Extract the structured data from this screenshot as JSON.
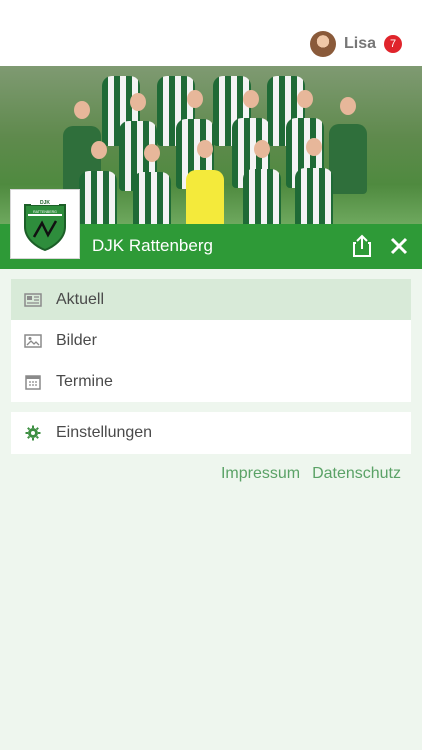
{
  "header": {
    "user_name": "Lisa",
    "notification_count": "7"
  },
  "club": {
    "name": "DJK Rattenberg",
    "logo_text": "DJK\nRATTENBERG E.V."
  },
  "menu": {
    "items": [
      {
        "label": "Aktuell",
        "icon": "newspaper-icon",
        "active": true
      },
      {
        "label": "Bilder",
        "icon": "image-icon",
        "active": false
      },
      {
        "label": "Termine",
        "icon": "calendar-icon",
        "active": false
      }
    ],
    "settings_label": "Einstellungen"
  },
  "footer": {
    "impressum": "Impressum",
    "datenschutz": "Datenschutz"
  },
  "colors": {
    "accent": "#2e9a37",
    "active_bg": "#d8ead8",
    "page_bg": "#eef6ee",
    "badge": "#e0242b"
  }
}
